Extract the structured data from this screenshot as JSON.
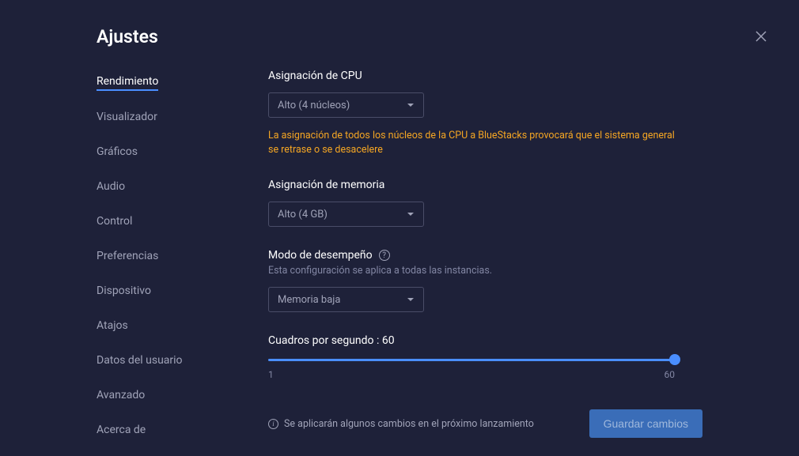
{
  "header": {
    "title": "Ajustes"
  },
  "sidebar": {
    "items": [
      {
        "label": "Rendimiento",
        "active": true
      },
      {
        "label": "Visualizador"
      },
      {
        "label": "Gráficos"
      },
      {
        "label": "Audio"
      },
      {
        "label": "Control"
      },
      {
        "label": "Preferencias"
      },
      {
        "label": "Dispositivo"
      },
      {
        "label": "Atajos"
      },
      {
        "label": "Datos del usuario"
      },
      {
        "label": "Avanzado"
      },
      {
        "label": "Acerca de"
      }
    ]
  },
  "sections": {
    "cpu": {
      "label": "Asignación de CPU",
      "value": "Alto (4 núcleos)",
      "warning": "La asignación de todos los núcleos de la CPU a BlueStacks provocará que el sistema general se retrase o se desacelere"
    },
    "memory": {
      "label": "Asignación de memoria",
      "value": "Alto (4 GB)"
    },
    "perfmode": {
      "label": "Modo de desempeño",
      "sublabel": "Esta configuración se aplica a todas las instancias.",
      "value": "Memoria baja"
    },
    "fps": {
      "label_prefix": "Cuadros por segundo : ",
      "value": "60",
      "min": "1",
      "max": "60"
    }
  },
  "footer": {
    "info": "Se aplicarán algunos cambios en el próximo lanzamiento",
    "save": "Guardar cambios"
  }
}
